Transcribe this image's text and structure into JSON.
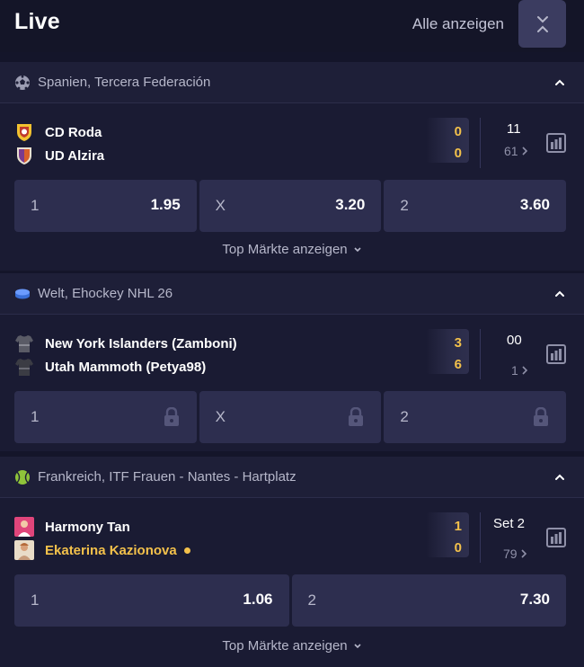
{
  "header": {
    "title": "Live",
    "show_all_label": "Alle anzeigen"
  },
  "colors": {
    "background": "#14152a",
    "card": "#1a1b33",
    "odd_button": "#2d2e4f",
    "accent_score": "#f3c14b",
    "text_muted": "#b6b7ca"
  },
  "events": [
    {
      "league_icon": "soccer-ball-icon",
      "league": "Spanien, Tercera Federación",
      "team1": "CD Roda",
      "team2": "UD Alzira",
      "score1": "0",
      "score2": "0",
      "time_main": "11",
      "more_markets": "61",
      "odds": [
        {
          "label": "1",
          "value": "1.95"
        },
        {
          "label": "X",
          "value": "3.20"
        },
        {
          "label": "2",
          "value": "3.60"
        }
      ],
      "top_markets_label": "Top Märkte anzeigen"
    },
    {
      "league_icon": "hockey-puck-icon",
      "league": "Welt, Ehockey NHL 26",
      "team1": "New York Islanders (Zamboni)",
      "team2": "Utah Mammoth (Petya98)",
      "score1": "3",
      "score2": "6",
      "time_main": "00",
      "more_markets": "1",
      "odds": [
        {
          "label": "1",
          "locked": true
        },
        {
          "label": "X",
          "locked": true
        },
        {
          "label": "2",
          "locked": true
        }
      ]
    },
    {
      "league_icon": "tennis-ball-icon",
      "league": "Frankreich, ITF Frauen - Nantes - Hartplatz",
      "team1": "Harmony Tan",
      "team2": "Ekaterina Kazionova",
      "score1": "1",
      "score2": "0",
      "time_main": "Set 2",
      "more_markets": "79",
      "odds": [
        {
          "label": "1",
          "value": "1.06"
        },
        {
          "label": "2",
          "value": "7.30"
        }
      ],
      "top_markets_label": "Top Märkte anzeigen"
    }
  ]
}
